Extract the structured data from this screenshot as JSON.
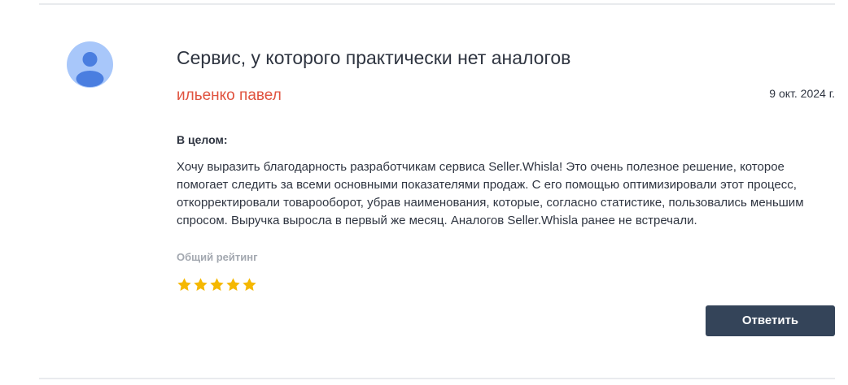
{
  "review": {
    "avatar_icon": "user-avatar-icon",
    "title": "Сервис, у которого практически нет аналогов",
    "author": "ильенко павел",
    "date": "9 окт. 2024 г.",
    "section_label": "В целом:",
    "text": "Хочу выразить благодарность разработчикам сервиса Seller.Whisla! Это очень полезное решение, которое помогает следить за всеми основными показателями продаж. С его помощью оптимизировали этот процесс, откорректировали товарооборот, убрав наименования, которые, согласно статистике, пользовались меньшим спросом. Выручка выросла в первый же месяц. Аналогов Seller.Whisla ранее не встречали.",
    "rating_label": "Общий рейтинг",
    "rating": 5,
    "rating_max": 5,
    "reply_label": "Ответить"
  },
  "colors": {
    "author": "#e0533f",
    "star": "#f5b800",
    "button_bg": "#344459",
    "avatar_bg": "#a8c7fa",
    "avatar_figure": "#4a7ee0"
  }
}
